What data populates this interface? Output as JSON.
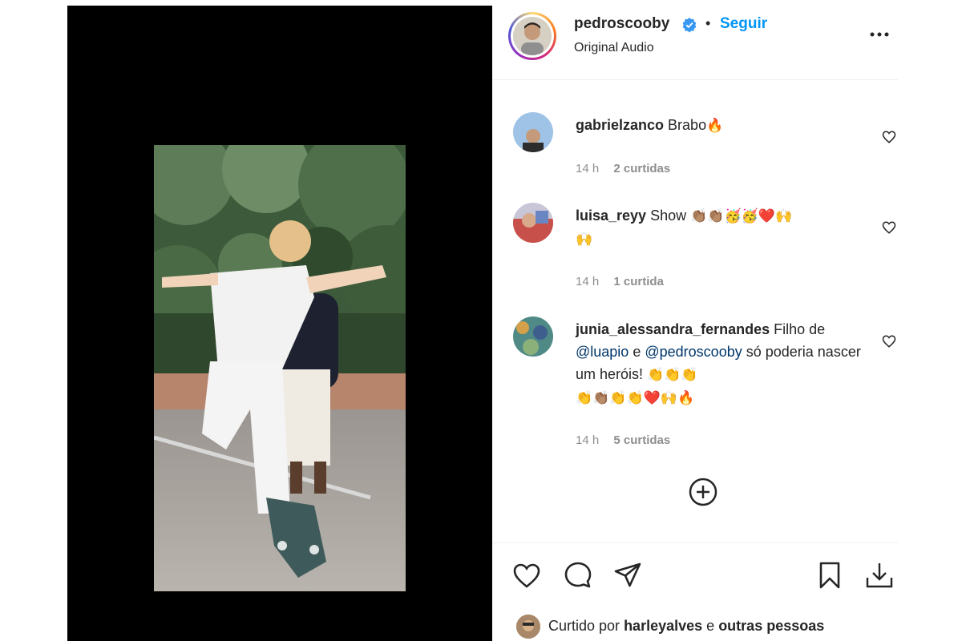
{
  "post": {
    "author": "pedroscooby",
    "follow_label": "Seguir",
    "separator": "•",
    "audio": "Original Audio"
  },
  "comments": [
    {
      "user": "gabrielzanco",
      "text_parts": [
        "Brabo"
      ],
      "emojis": [
        "🔥"
      ],
      "time": "14 h",
      "likes": "2 curtidas"
    },
    {
      "user": "luisa_reyy",
      "text": "Show",
      "emojis_line1": [
        "👏🏽",
        "👏🏽",
        "🥳",
        "🥳",
        "❤️",
        "🙌"
      ],
      "emojis_line2": [
        "🙌"
      ],
      "time": "14 h",
      "likes": "1 curtida"
    },
    {
      "user": "junia_alessandra_fernandes",
      "text_a": "Filho de",
      "mention_1": "@luapio",
      "text_b": "e",
      "mention_2": "@pedroscooby",
      "text_c": "só poderia nascer um heróis!",
      "emojis_line1": [
        "👏",
        "👏",
        "👏"
      ],
      "emojis_line2": [
        "👏",
        "👏🏽",
        "👏",
        "👏",
        "❤️",
        "🙌",
        "🔥"
      ],
      "time": "14 h",
      "likes": "5 curtidas"
    }
  ],
  "footer": {
    "liked_prefix": "Curtido por",
    "liked_user": "harleyalves",
    "liked_and": "e",
    "liked_others": "outras pessoas"
  },
  "icons": {
    "heart": "heart-icon",
    "comment": "comment-icon",
    "share": "share-icon",
    "save": "bookmark-icon",
    "download": "download-icon",
    "more": "more-options-icon",
    "add": "add-circle-icon",
    "verified": "verified-badge-icon"
  },
  "colors": {
    "link": "#0095f6",
    "mention": "#00376b",
    "muted": "#8e8e8e",
    "media_bg": "#000000"
  }
}
